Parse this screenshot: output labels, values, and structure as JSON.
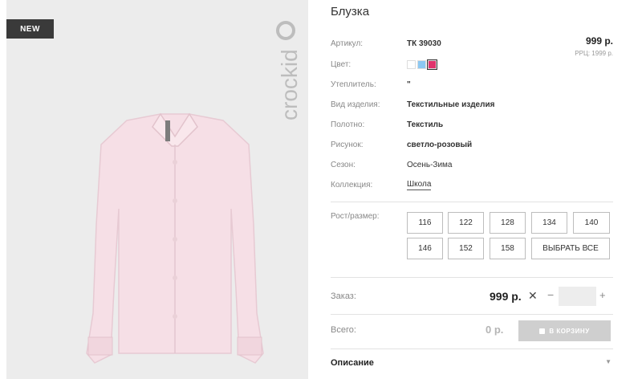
{
  "photo": {
    "badge": "NEW",
    "brand": "crockid",
    "image_alt": "pink blouse"
  },
  "product": {
    "title": "Блузка",
    "price": "999 р.",
    "rrp": "РРЦ: 1999 р.",
    "attributes": [
      {
        "label": "Артикул:",
        "value": "ТК 39030"
      },
      {
        "label": "Цвет:",
        "value": ""
      },
      {
        "label": "Утеплитель:",
        "value": "\""
      },
      {
        "label": "Вид изделия:",
        "value": "Текстильные изделия"
      },
      {
        "label": "Полотно:",
        "value": "Текстиль"
      },
      {
        "label": "Рисунок:",
        "value": "светло-розовый"
      },
      {
        "label": "Сезон:",
        "value": "Осень-Зима"
      },
      {
        "label": "Коллекция:",
        "value": "Школа"
      }
    ],
    "colors": [
      "#ffffff",
      "#8cc8f2",
      "#e0336c"
    ],
    "sizes_label": "Рост/размер:",
    "sizes": [
      "116",
      "122",
      "128",
      "134",
      "140",
      "146",
      "152",
      "158"
    ],
    "select_all": "ВЫБРАТЬ ВСЕ"
  },
  "order": {
    "label": "Заказ:",
    "price": "999 р.",
    "remove": "✕",
    "minus": "−",
    "plus": "+",
    "qty": ""
  },
  "total": {
    "label": "Всего:",
    "value": "0 р.",
    "cart_button": "В КОРЗИНУ"
  },
  "description": {
    "label": "Описание",
    "chevron": "▼"
  }
}
